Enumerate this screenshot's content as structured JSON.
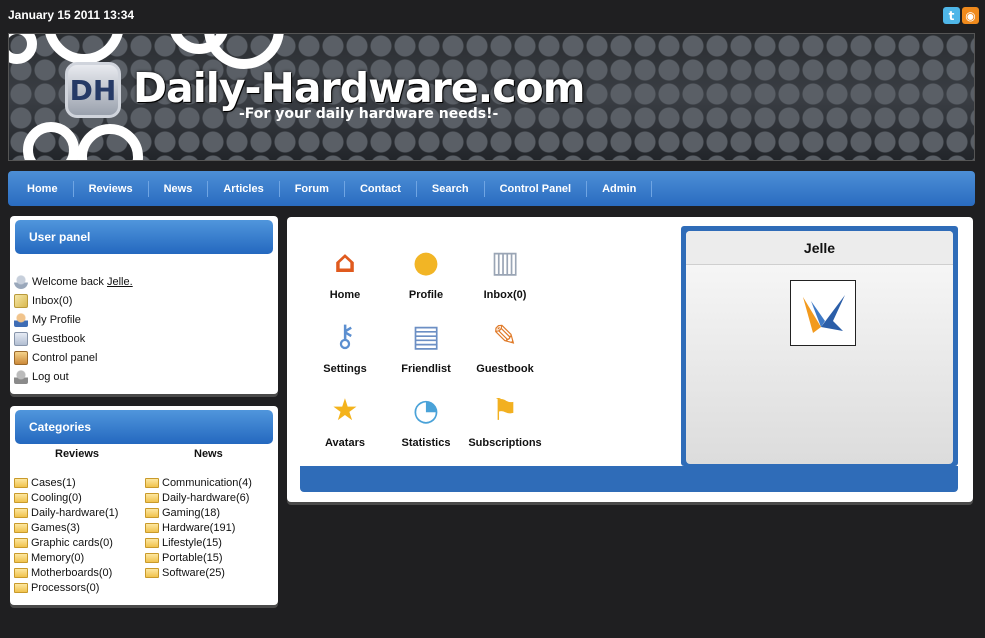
{
  "header": {
    "datetime": "January 15 2011 13:34",
    "site_title": "Daily-Hardware.com",
    "slogan": "-For your daily hardware needs!-",
    "logo_text": "DH",
    "social": [
      {
        "name": "twitter",
        "icon": "twitter-icon",
        "glyph": "t",
        "color": "#4fb6e8"
      },
      {
        "name": "rss",
        "icon": "rss-icon",
        "glyph": "◉",
        "color": "#f08a1c"
      }
    ]
  },
  "nav": {
    "items": [
      "Home",
      "Reviews",
      "News",
      "Articles",
      "Forum",
      "Contact",
      "Search",
      "Control Panel",
      "Admin"
    ]
  },
  "user_panel": {
    "title": "User panel",
    "welcome_prefix": "Welcome back",
    "username_link": "Jelle.",
    "items": [
      {
        "label": "Inbox(0)",
        "icon": "mail-icon"
      },
      {
        "label": "My Profile",
        "icon": "profile-icon"
      },
      {
        "label": "Guestbook",
        "icon": "guestbook-icon"
      },
      {
        "label": "Control panel",
        "icon": "control-panel-icon"
      },
      {
        "label": "Log out",
        "icon": "logout-icon"
      }
    ]
  },
  "categories": {
    "title": "Categories",
    "reviews_header": "Reviews",
    "news_header": "News",
    "reviews": [
      "Cases(1)",
      "Cooling(0)",
      "Daily-hardware(1)",
      "Games(3)",
      "Graphic cards(0)",
      "Memory(0)",
      "Motherboards(0)",
      "Processors(0)"
    ],
    "news": [
      "Communication(4)",
      "Daily-hardware(6)",
      "Gaming(18)",
      "Hardware(191)",
      "Lifestyle(15)",
      "Portable(15)",
      "Software(25)"
    ]
  },
  "dashboard": {
    "tiles": [
      {
        "label": "Home",
        "icon": "home-icon",
        "glyph": "⌂",
        "color": "#e05a1e"
      },
      {
        "label": "Profile",
        "icon": "profile-icon",
        "glyph": "●",
        "color": "#f2b525"
      },
      {
        "label": "Inbox(0)",
        "icon": "inbox-icon",
        "glyph": "▥",
        "color": "#9aa5b5"
      },
      {
        "label": "Settings",
        "icon": "settings-key-icon",
        "glyph": "⚷",
        "color": "#5c8fd0"
      },
      {
        "label": "Friendlist",
        "icon": "friendlist-icon",
        "glyph": "▤",
        "color": "#6c8fc4"
      },
      {
        "label": "Guestbook",
        "icon": "pencil-icon",
        "glyph": "✎",
        "color": "#e07b2a"
      },
      {
        "label": "Avatars",
        "icon": "star-icon",
        "glyph": "★",
        "color": "#f4b31c"
      },
      {
        "label": "Statistics",
        "icon": "pie-chart-icon",
        "glyph": "◔",
        "color": "#4aa2d8"
      },
      {
        "label": "Subscriptions",
        "icon": "flag-icon",
        "glyph": "⚑",
        "color": "#f2b020"
      }
    ]
  },
  "profile_box": {
    "name": "Jelle"
  }
}
